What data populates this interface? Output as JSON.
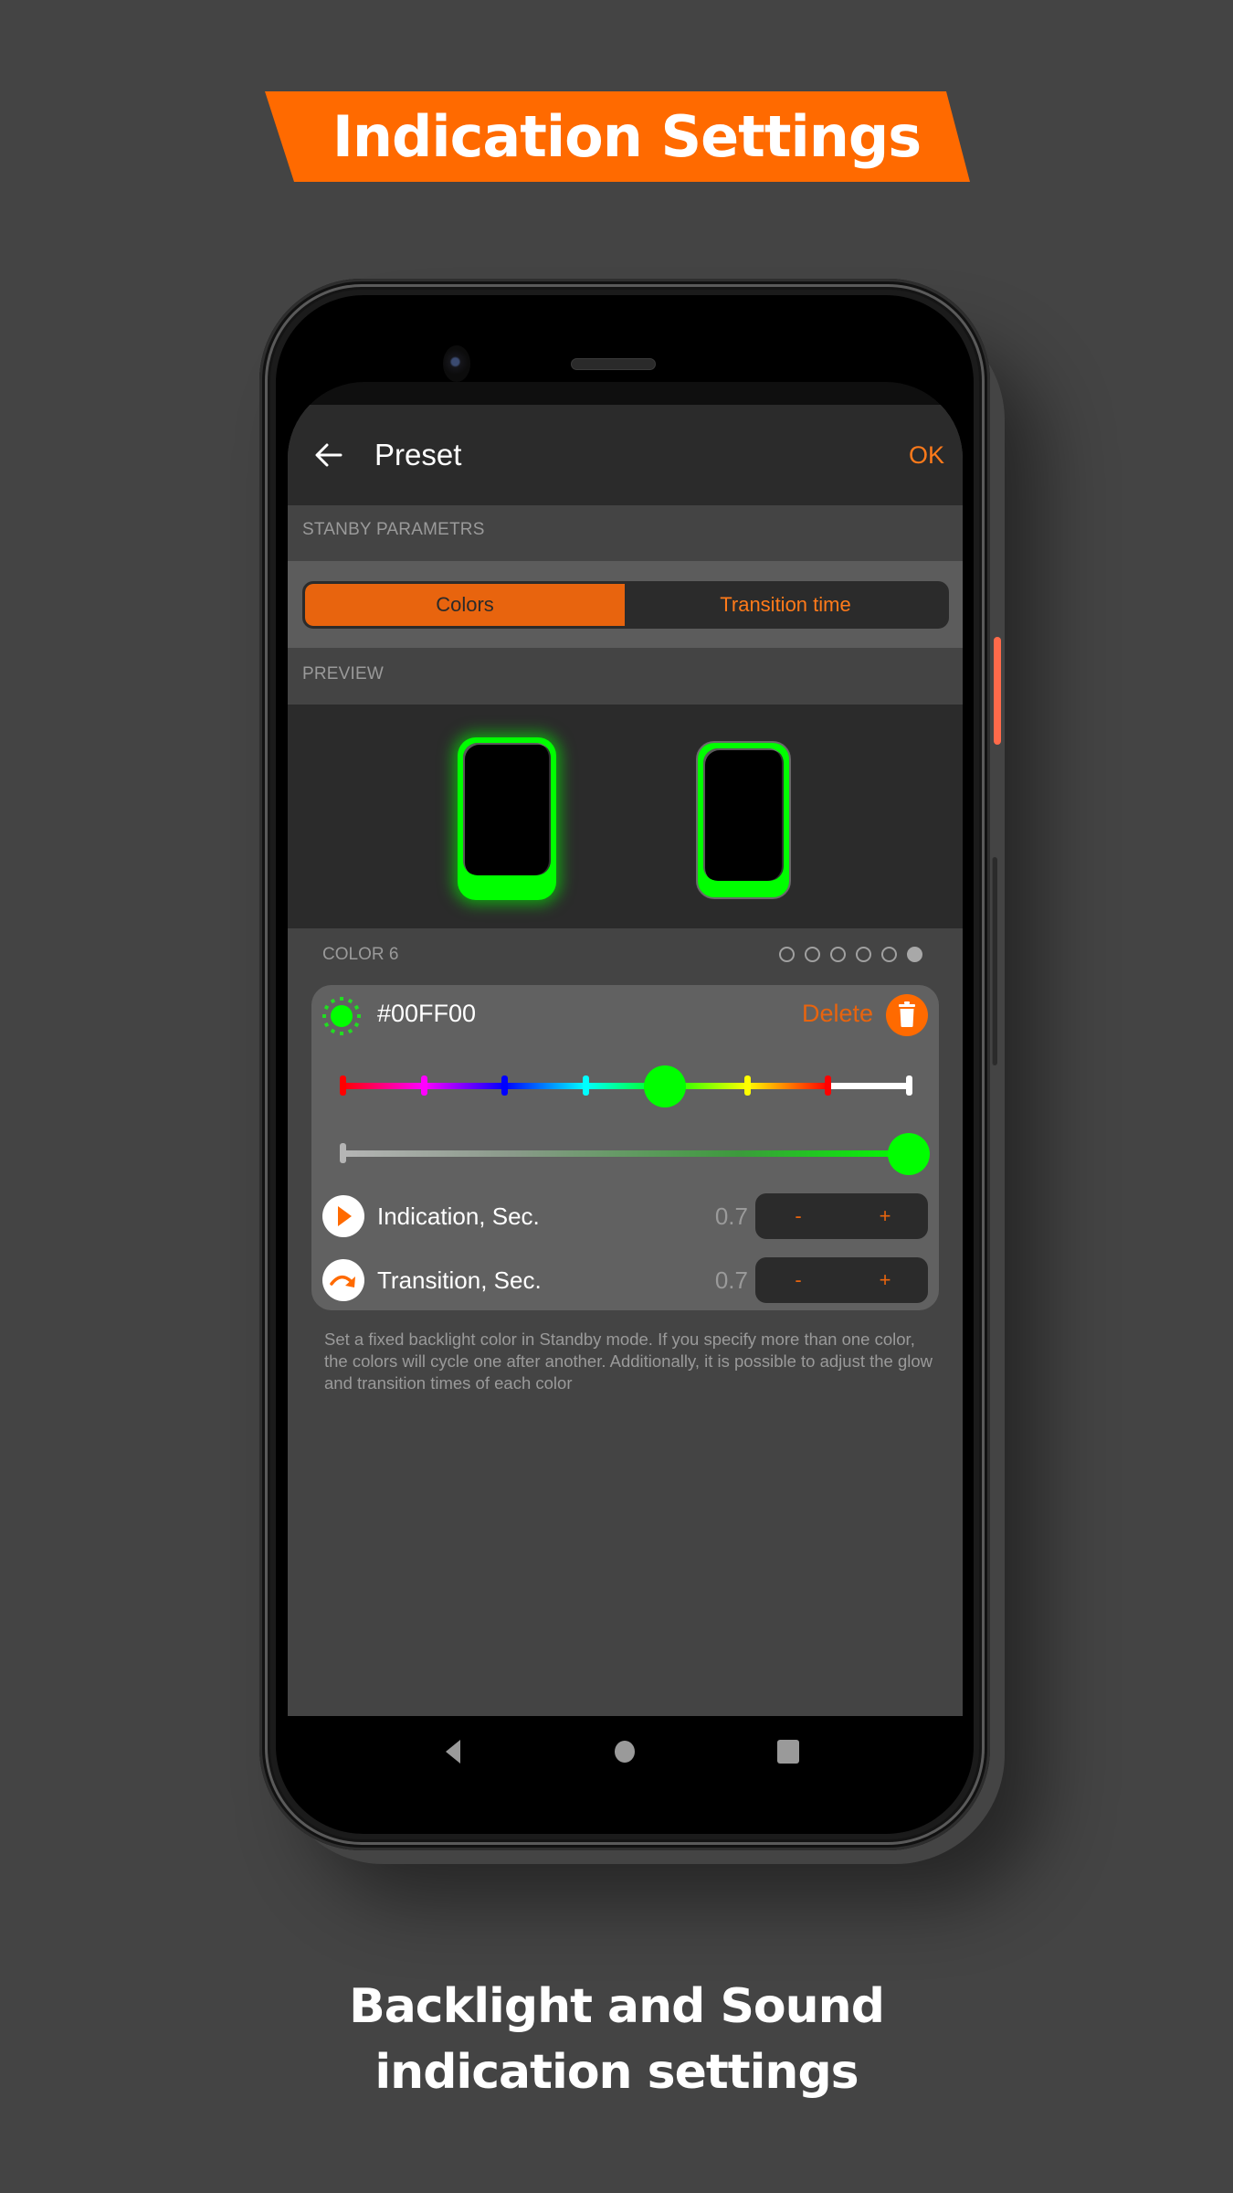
{
  "banner": {
    "title": "Indication Settings",
    "color": "#ff6a00"
  },
  "app": {
    "title": "Preset",
    "ok_label": "OK",
    "accent": "#e8640e",
    "sections": {
      "standby": "STANBY PARAMETRS",
      "preview": "PREVIEW"
    },
    "tabs": [
      {
        "label": "Colors",
        "active": true
      },
      {
        "label": "Transition time",
        "active": false
      }
    ],
    "preview": {
      "glow_color": "#00FF00",
      "devices": [
        "glowing",
        "standard"
      ]
    },
    "color_editor": {
      "label": "COLOR 6",
      "page_count": 6,
      "active_index": 6,
      "hex": "#00FF00",
      "delete_label": "Delete",
      "hue_stops": [
        "#FF0000",
        "#FF00FF",
        "#0000FF",
        "#00FFFF",
        "#00FF00",
        "#FFFF00",
        "#FF0000",
        "#FFFFFF"
      ],
      "hue_position": 0.57,
      "brightness": 1.0,
      "params": [
        {
          "label": "Indication, Sec.",
          "value": "0.7",
          "icon": "play-icon",
          "minus": "-",
          "plus": "+"
        },
        {
          "label": "Transition, Sec.",
          "value": "0.7",
          "icon": "redo-arrow-icon",
          "minus": "-",
          "plus": "+"
        }
      ]
    },
    "hint": "Set a fixed backlight color in Standby mode. If you specify more than one color, the colors will cycle one after another. Additionally, it is possible to adjust the glow and transition times of each color"
  },
  "navbar": {
    "buttons": [
      "back",
      "home",
      "recents"
    ]
  },
  "footer": {
    "line1": "Backlight and Sound",
    "line2": "indication settings"
  }
}
